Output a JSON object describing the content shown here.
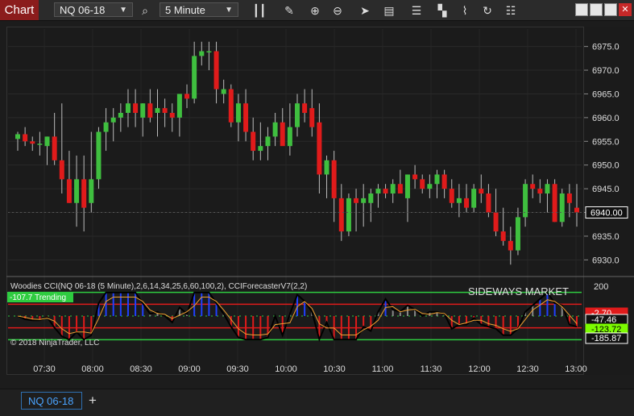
{
  "toolbar": {
    "chart_tab": "Chart",
    "instrument": "NQ 06-18",
    "interval": "5 Minute",
    "icons": [
      "search-icon",
      "bar-type-icon",
      "pencil-icon",
      "zoom-in-icon",
      "zoom-out-icon",
      "pointer-icon",
      "data-box-icon",
      "indicators-icon",
      "strategies-icon",
      "drawing-tools-icon",
      "refresh-icon",
      "properties-icon"
    ]
  },
  "colors": {
    "up": "#3fbf3f",
    "down": "#e01b1b",
    "accent": "#8b1c1c",
    "tab_blue": "#2f6fb0"
  },
  "price_axis": {
    "labels": [
      "6975.0",
      "6970.0",
      "6965.0",
      "6960.0",
      "6955.0",
      "6950.0",
      "6945.0",
      "6940.0",
      "6935.0",
      "6930.0"
    ],
    "current": "6940.00"
  },
  "indicator": {
    "title": "Woodies CCI(NQ 06-18 (5 Minute),2,6,14,34,25,6,60,100,2), CCIForecasterV7(2,2)",
    "trend_label": "-107.7 Trending",
    "sideways": "SIDEWAYS MARKET",
    "copyright": "© 2018 NinjaTrader, LLC",
    "axis_top": "200",
    "values": [
      "-2.70",
      "-47.46",
      "-123.72",
      "-185.87"
    ]
  },
  "time_axis": [
    "07:30",
    "08:00",
    "08:30",
    "09:00",
    "09:30",
    "10:00",
    "10:30",
    "11:00",
    "11:30",
    "12:00",
    "12:30",
    "13:00"
  ],
  "bottom": {
    "tab": "NQ 06-18",
    "add": "+"
  },
  "chart_data": {
    "type": "candlestick",
    "candles": [
      [
        6955.5,
        6957,
        6953,
        6956.5
      ],
      [
        6956.5,
        6958,
        6954,
        6955.0
      ],
      [
        6955.0,
        6956,
        6953,
        6954.5
      ],
      [
        6954.5,
        6957,
        6952,
        6954.5
      ],
      [
        6954.0,
        6956,
        6950,
        6956.0
      ],
      [
        6956.0,
        6961,
        6950,
        6951.0
      ],
      [
        6951.0,
        6963,
        6944,
        6947.0
      ],
      [
        6947.0,
        6953,
        6942,
        6942.0
      ],
      [
        6942.0,
        6952,
        6937,
        6947.0
      ],
      [
        6947.0,
        6952,
        6936,
        6941.0
      ],
      [
        6942.0,
        6957,
        6940,
        6947.0
      ],
      [
        6947.0,
        6958,
        6945,
        6957.0
      ],
      [
        6957.0,
        6962,
        6953,
        6959.0
      ],
      [
        6959.0,
        6962,
        6955,
        6960.0
      ],
      [
        6960.0,
        6963,
        6957,
        6961.0
      ],
      [
        6961.0,
        6966,
        6958,
        6963.0
      ],
      [
        6963.0,
        6966,
        6958,
        6961.0
      ],
      [
        6960.0,
        6963,
        6956,
        6963.0
      ],
      [
        6963.0,
        6966,
        6959,
        6960.0
      ],
      [
        6961.0,
        6966,
        6956,
        6962.0
      ],
      [
        6962.0,
        6964,
        6958,
        6961.0
      ],
      [
        6961.0,
        6963,
        6957,
        6960.0
      ],
      [
        6960.0,
        6964,
        6956,
        6965.0
      ],
      [
        6965.0,
        6967,
        6962,
        6964.0
      ],
      [
        6964.0,
        6976,
        6963,
        6973.0
      ],
      [
        6973.0,
        6976,
        6971,
        6974.0
      ],
      [
        6974.0,
        6976,
        6970,
        6974.0
      ],
      [
        6974.0,
        6976,
        6963,
        6966.0
      ],
      [
        6965.0,
        6968,
        6963,
        6966.0
      ],
      [
        6966.0,
        6967,
        6958,
        6959.0
      ],
      [
        6959.0,
        6965,
        6955,
        6963.0
      ],
      [
        6963.0,
        6966,
        6955,
        6957.0
      ],
      [
        6957.0,
        6960,
        6951,
        6953.0
      ],
      [
        6953.0,
        6959,
        6951,
        6954.0
      ],
      [
        6954.0,
        6958,
        6951,
        6956.0
      ],
      [
        6956.0,
        6961,
        6954,
        6959.0
      ],
      [
        6959.0,
        6962,
        6955,
        6954.0
      ],
      [
        6954.0,
        6963,
        6952,
        6958.0
      ],
      [
        6958.0,
        6965,
        6956,
        6963.0
      ],
      [
        6963.0,
        6966,
        6959,
        6961.0
      ],
      [
        6962.0,
        6966,
        6956,
        6958.0
      ],
      [
        6959.0,
        6963,
        6944,
        6948.0
      ],
      [
        6948.0,
        6952,
        6943,
        6951.0
      ],
      [
        6951.0,
        6953,
        6938,
        6943.0
      ],
      [
        6943.0,
        6946,
        6934,
        6936.0
      ],
      [
        6936.0,
        6944,
        6935,
        6943.0
      ],
      [
        6943.0,
        6945,
        6936,
        6942.0
      ],
      [
        6942.0,
        6946,
        6937,
        6943.0
      ],
      [
        6942.0,
        6945,
        6938,
        6944.0
      ],
      [
        6944.0,
        6946,
        6941,
        6945.0
      ],
      [
        6945.0,
        6946,
        6943,
        6944.0
      ],
      [
        6944.0,
        6947,
        6942,
        6946.0
      ],
      [
        6946.0,
        6949,
        6944,
        6944.0
      ],
      [
        6943.0,
        6948,
        6938,
        6948.0
      ],
      [
        6948.0,
        6950,
        6945,
        6947.0
      ],
      [
        6947.0,
        6948,
        6944,
        6945.0
      ],
      [
        6945.0,
        6948,
        6943,
        6946.0
      ],
      [
        6946.0,
        6949,
        6943,
        6948.0
      ],
      [
        6948.0,
        6949,
        6943,
        6945.0
      ],
      [
        6945.0,
        6947,
        6941,
        6942.0
      ],
      [
        6942.0,
        6946,
        6939,
        6943.0
      ],
      [
        6943.0,
        6946,
        6940,
        6941.0
      ],
      [
        6941.0,
        6946,
        6940,
        6945.0
      ],
      [
        6945.0,
        6948,
        6942,
        6944.0
      ],
      [
        6944.0,
        6946,
        6939,
        6940.0
      ],
      [
        6940.0,
        6945,
        6935,
        6936.0
      ],
      [
        6936.0,
        6941,
        6933,
        6934.0
      ],
      [
        6934.0,
        6937,
        6929,
        6932.0
      ],
      [
        6932.0,
        6941,
        6931,
        6939.0
      ],
      [
        6939.0,
        6947,
        6937,
        6946.0
      ],
      [
        6946.0,
        6948,
        6943,
        6945.0
      ],
      [
        6945.0,
        6947,
        6942,
        6944.0
      ],
      [
        6944.0,
        6947,
        6940,
        6946.0
      ],
      [
        6946.0,
        6947,
        6938,
        6938.0
      ],
      [
        6938.0,
        6945,
        6937,
        6944.0
      ],
      [
        6944.0,
        6946,
        6939,
        6942.0
      ],
      [
        6941.0,
        6946,
        6937,
        6940.0
      ]
    ],
    "ylim": [
      6927,
      6978
    ],
    "cci_ylim": [
      -300,
      300
    ],
    "cci_levels": [
      200,
      100,
      0,
      -100,
      -200
    ]
  }
}
